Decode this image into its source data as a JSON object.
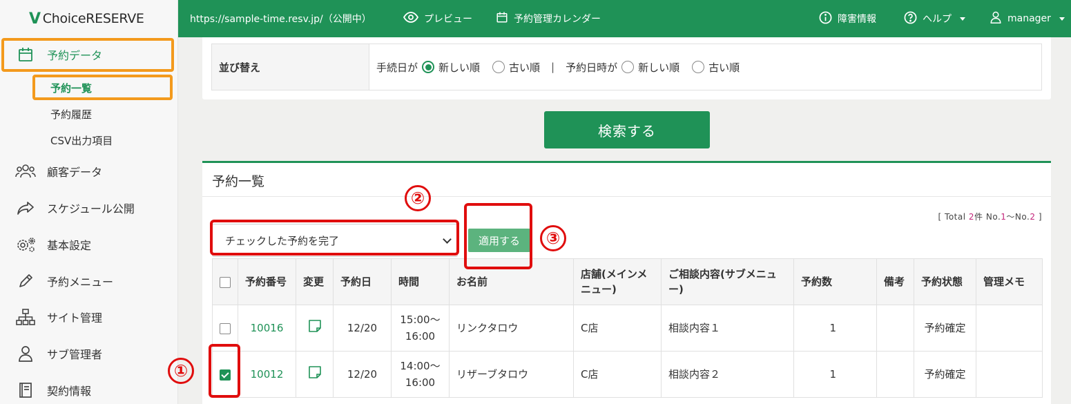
{
  "sidebar": {
    "logo_mark": "V",
    "logo_text": "ChoiceRESERVE",
    "items": [
      {
        "label": "予約データ",
        "icon": "calendar-icon"
      },
      {
        "label": "顧客データ",
        "icon": "users-icon"
      },
      {
        "label": "スケジュール公開",
        "icon": "share-icon"
      },
      {
        "label": "基本設定",
        "icon": "gears-icon"
      },
      {
        "label": "予約メニュー",
        "icon": "pencil-icon"
      },
      {
        "label": "サイト管理",
        "icon": "sitemap-icon"
      },
      {
        "label": "サブ管理者",
        "icon": "user-icon"
      },
      {
        "label": "契約情報",
        "icon": "book-icon"
      }
    ],
    "sub_items": [
      "予約一覧",
      "予約履歴",
      "CSV出力項目"
    ]
  },
  "header": {
    "url": "https://sample-time.resv.jp/（公開中）",
    "preview": "プレビュー",
    "calendar": "予約管理カレンダー",
    "failure_info": "障害情報",
    "help": "ヘルプ",
    "user": "manager"
  },
  "sort": {
    "label": "並び替え",
    "proc_date": "手続日が",
    "newest": "新しい順",
    "oldest": "古い順",
    "separator": "|",
    "resv_datetime": "予約日時が"
  },
  "search_button": "検索する",
  "list": {
    "title": "予約一覧",
    "total_prefix": "[ Total ",
    "total_count": "2",
    "total_mid": "件 No.",
    "range_start": "1",
    "range_sep": "～No.",
    "range_end": "2",
    "total_suffix": " ]",
    "bulk_action": "チェックした予約を完了",
    "apply_button": "適用する",
    "columns": [
      "予約番号",
      "変更",
      "予約日",
      "時間",
      "お名前",
      "店舗(メインメニュー)",
      "ご相談内容(サブメニュー)",
      "予約数",
      "備考",
      "予約状態",
      "管理メモ"
    ],
    "rows": [
      {
        "checked": false,
        "id": "10016",
        "date": "12/20",
        "time_start": "15:00～",
        "time_end": "16:00",
        "name": "リンクタロウ",
        "store": "C店",
        "consult": "相談内容１",
        "count": "1",
        "note": "",
        "status": "予約確定",
        "memo": ""
      },
      {
        "checked": true,
        "id": "10012",
        "date": "12/20",
        "time_start": "14:00～",
        "time_end": "16:00",
        "name": "リザーブタロウ",
        "store": "C店",
        "consult": "相談内容２",
        "count": "1",
        "note": "",
        "status": "予約確定",
        "memo": ""
      }
    ]
  },
  "annotations": [
    "①",
    "②",
    "③"
  ],
  "colors": {
    "brand": "#1f9257",
    "highlight_orange": "#f39a1d",
    "highlight_red": "#e00d0d"
  }
}
